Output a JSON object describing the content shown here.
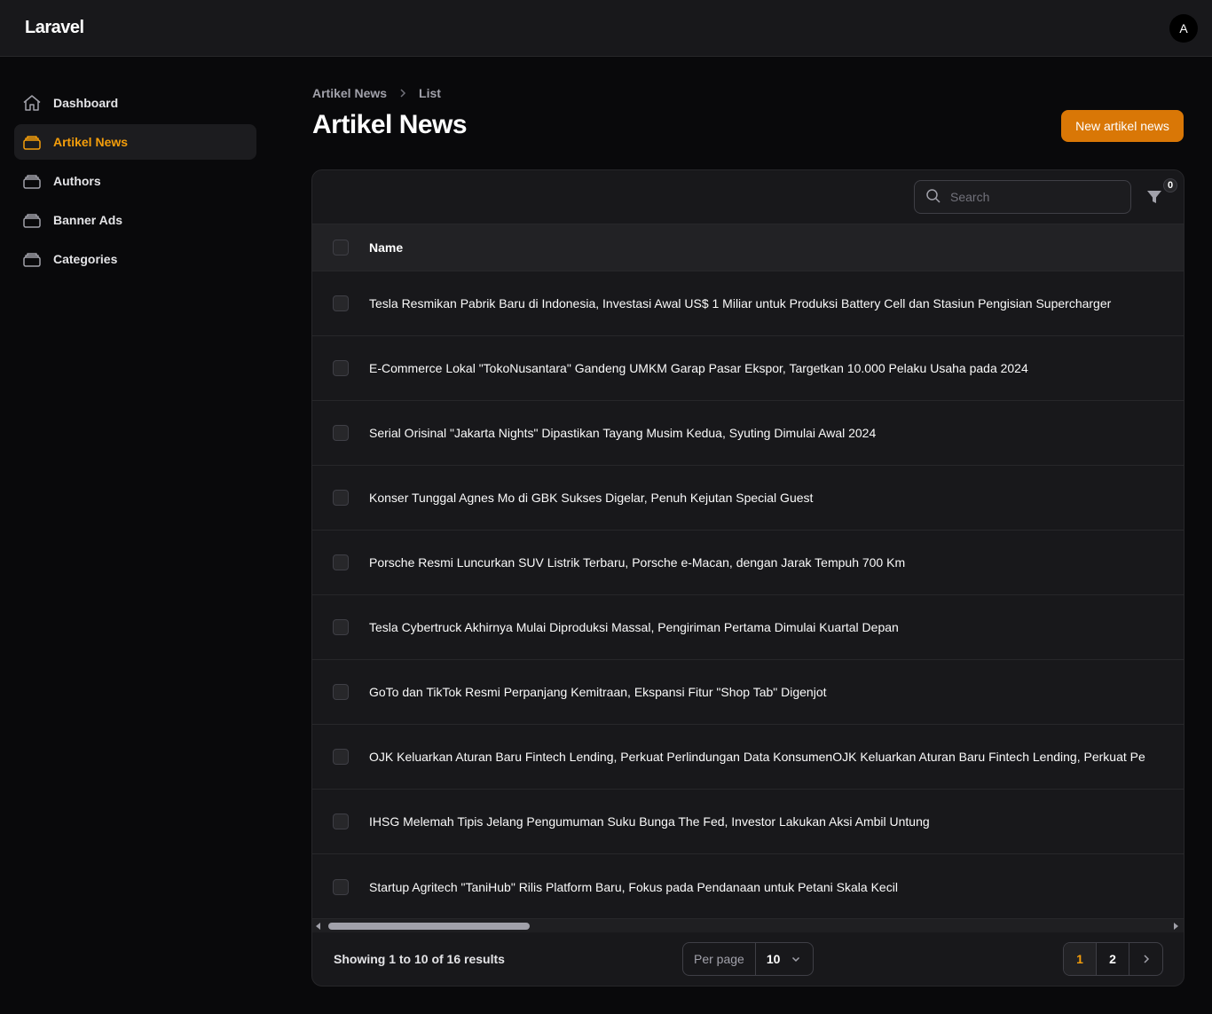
{
  "app": {
    "brand": "Laravel",
    "user_initial": "A"
  },
  "sidebar": {
    "items": [
      {
        "label": "Dashboard",
        "icon": "home-icon"
      },
      {
        "label": "Artikel News",
        "icon": "rectangle-stack-icon",
        "active": true
      },
      {
        "label": "Authors",
        "icon": "rectangle-stack-icon"
      },
      {
        "label": "Banner Ads",
        "icon": "rectangle-stack-icon"
      },
      {
        "label": "Categories",
        "icon": "rectangle-stack-icon"
      }
    ]
  },
  "breadcrumb": {
    "parent": "Artikel News",
    "current": "List"
  },
  "page": {
    "title": "Artikel News",
    "new_button": "New artikel news"
  },
  "table": {
    "search_placeholder": "Search",
    "filter_count": "0",
    "columns": [
      "Name"
    ],
    "rows": [
      "Tesla Resmikan Pabrik Baru di Indonesia, Investasi Awal US$ 1 Miliar untuk Produksi Battery Cell dan Stasiun Pengisian Supercharger",
      "E-Commerce Lokal \"TokoNusantara\" Gandeng UMKM Garap Pasar Ekspor, Targetkan 10.000 Pelaku Usaha pada 2024",
      "Serial Orisinal \"Jakarta Nights\" Dipastikan Tayang Musim Kedua, Syuting Dimulai Awal 2024",
      "Konser Tunggal Agnes Mo di GBK Sukses Digelar, Penuh Kejutan Special Guest",
      "Porsche Resmi Luncurkan SUV Listrik Terbaru, Porsche e-Macan, dengan Jarak Tempuh 700 Km",
      "Tesla Cybertruck Akhirnya Mulai Diproduksi Massal, Pengiriman Pertama Dimulai Kuartal Depan",
      "GoTo dan TikTok Resmi Perpanjang Kemitraan, Ekspansi Fitur \"Shop Tab\" Digenjot",
      "OJK Keluarkan Aturan Baru Fintech Lending, Perkuat Perlindungan Data KonsumenOJK Keluarkan Aturan Baru Fintech Lending, Perkuat Pe",
      "IHSG Melemah Tipis Jelang Pengumuman Suku Bunga The Fed, Investor Lakukan Aksi Ambil Untung",
      "Startup Agritech \"TaniHub\" Rilis Platform Baru, Fokus pada Pendanaan untuk Petani Skala Kecil"
    ]
  },
  "footer": {
    "showing": "Showing 1 to 10 of 16 results",
    "per_page_label": "Per page",
    "per_page_value": "10",
    "pages": [
      "1",
      "2"
    ],
    "current_page": "1"
  },
  "colors": {
    "accent": "#f59e0b",
    "button": "#d97706",
    "background": "#09090b",
    "panel": "#18181b"
  }
}
